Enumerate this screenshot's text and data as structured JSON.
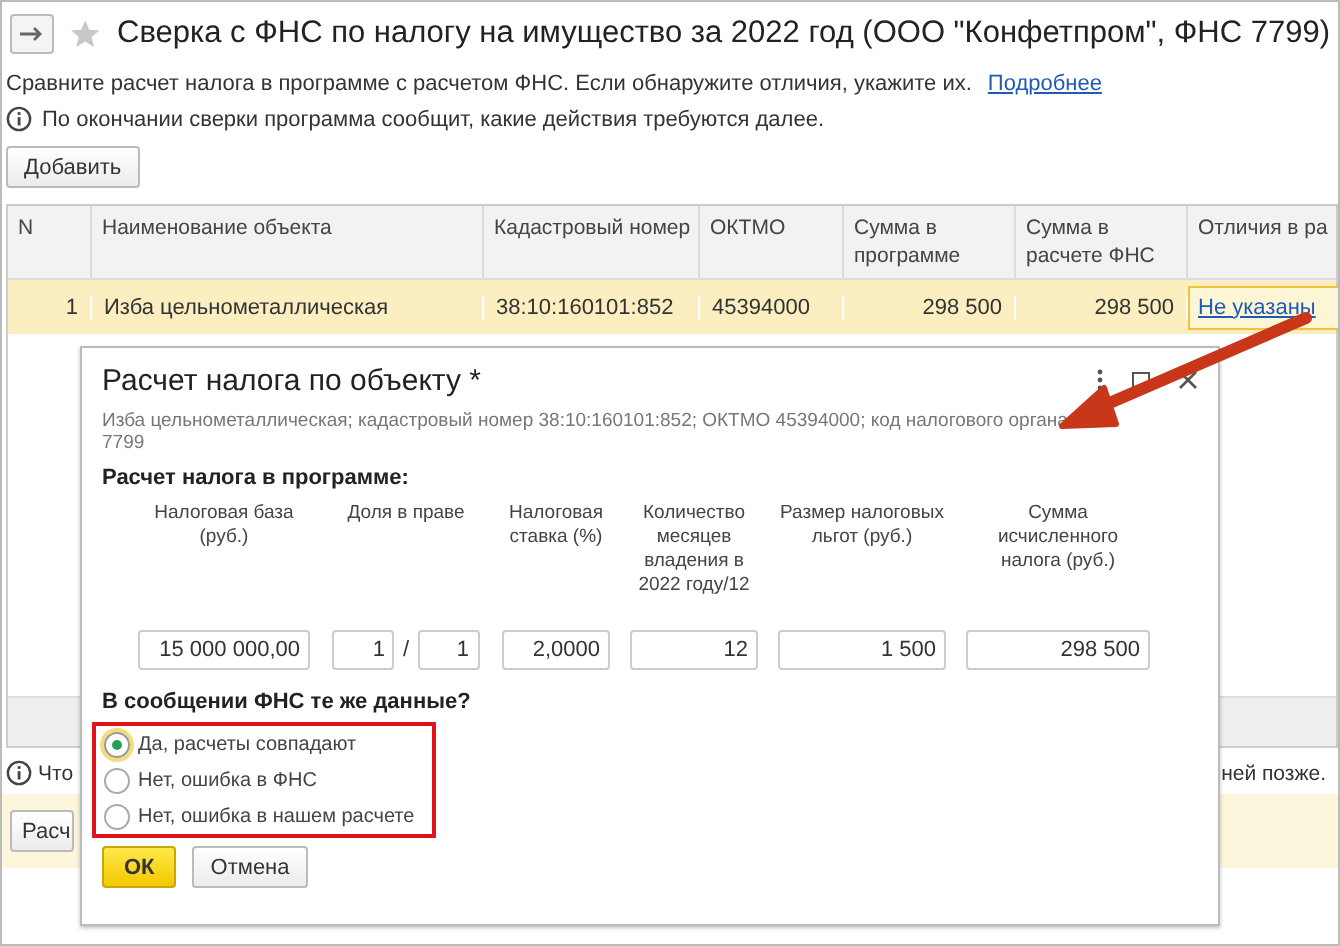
{
  "window": {
    "title": "Сверка с ФНС по налогу на имущество за 2022 год (ООО \"Конфетпром\", ФНС 7799)"
  },
  "intro": {
    "text": "Сравните расчет налога в программе с расчетом ФНС. Если обнаружите отличия, укажите их.",
    "link": "Подробнее"
  },
  "info": "По окончании сверки программа сообщит, какие действия требуются далее.",
  "add_button": "Добавить",
  "table": {
    "columns": [
      "N",
      "Наименование объекта",
      "Кадастровый номер",
      "ОКТМО",
      "Сумма в программе",
      "Сумма в расчете ФНС",
      "Отличия в ра"
    ],
    "rows": [
      {
        "selected": true,
        "cells": [
          "1",
          "Изба цельнометаллическая",
          "38:10:160101:852",
          "45394000",
          "298 500",
          "298 500"
        ],
        "link": "Не указаны"
      }
    ]
  },
  "bottom_info": {
    "left": "Что",
    "right": "ней позже."
  },
  "bottom_button": "Расч",
  "dialog": {
    "title": "Расчет налога по объекту *",
    "subtitle": "Изба цельнометаллическая; кадастровый номер 38:10:160101:852; ОКТМО 45394000; код налогового органа 7799",
    "section": "Расчет налога в программе:",
    "fields": [
      {
        "kind": "single",
        "label": "Налоговая база (руб.)",
        "value": "15 000 000,00"
      },
      {
        "kind": "fraction",
        "label": "Доля в праве",
        "numerator": "1",
        "separator": "/",
        "denominator": "1"
      },
      {
        "kind": "single",
        "label": "Налоговая ставка (%)",
        "value": "2,0000"
      },
      {
        "kind": "single",
        "label": "Количество месяцев владения в 2022 году/12",
        "value": "12"
      },
      {
        "kind": "single",
        "label": "Размер налоговых льгот (руб.)",
        "value": "1 500"
      },
      {
        "kind": "single",
        "label": "Сумма исчисленного налога (руб.)",
        "value": "298 500"
      }
    ],
    "question": "В сообщении ФНС те же данные?",
    "options": [
      {
        "label": "Да, расчеты совпадают",
        "selected": true
      },
      {
        "label": "Нет, ошибка в ФНС",
        "selected": false
      },
      {
        "label": "Нет, ошибка в нашем расчете",
        "selected": false
      }
    ],
    "ok": "ОК",
    "cancel": "Отмена"
  }
}
